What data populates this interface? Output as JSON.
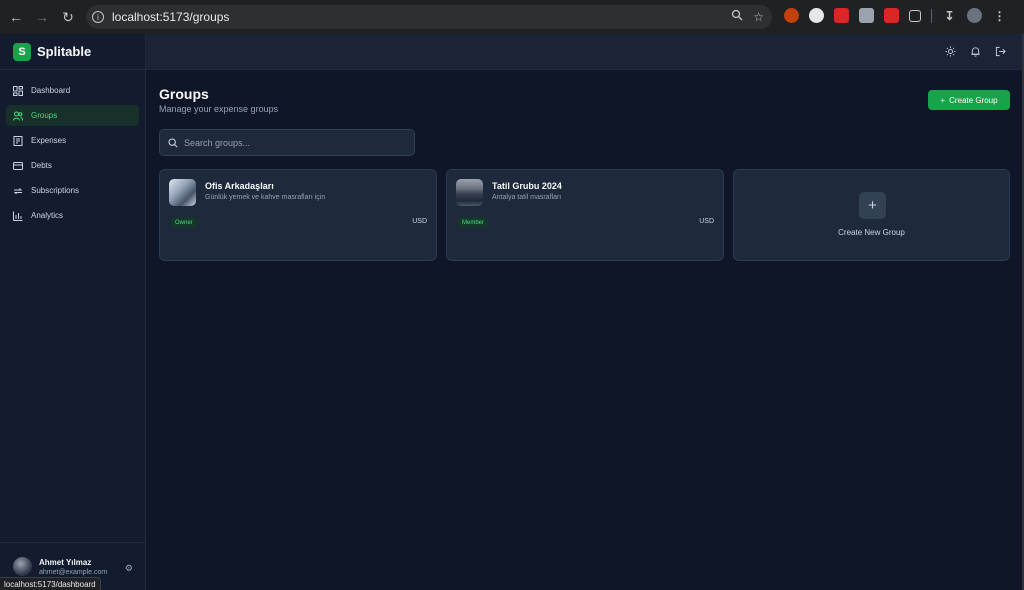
{
  "browser": {
    "url": "localhost:5173/groups",
    "status_url": "localhost:5173/dashboard"
  },
  "app": {
    "brand_letter": "S",
    "brand_name": "Splitable"
  },
  "sidebar": {
    "items": [
      {
        "label": "Dashboard",
        "icon": "dashboard-icon",
        "active": false
      },
      {
        "label": "Groups",
        "icon": "users-icon",
        "active": true
      },
      {
        "label": "Expenses",
        "icon": "receipt-icon",
        "active": false
      },
      {
        "label": "Debts",
        "icon": "credit-card-icon",
        "active": false
      },
      {
        "label": "Subscriptions",
        "icon": "repeat-icon",
        "active": false
      },
      {
        "label": "Analytics",
        "icon": "bar-chart-icon",
        "active": false
      }
    ]
  },
  "user": {
    "name": "Ahmet Yılmaz",
    "email": "ahmet@example.com"
  },
  "page": {
    "title": "Groups",
    "subtitle": "Manage your expense groups",
    "create_button": "Create Group"
  },
  "search": {
    "placeholder": "Search groups..."
  },
  "groups": [
    {
      "name": "Ofis Arkadaşları",
      "description": "Günlük yemek ve kahve masrafları için",
      "role": "Owner",
      "currency": "USD"
    },
    {
      "name": "Tatil Grubu 2024",
      "description": "Antalya tatil masrafları",
      "role": "Member",
      "currency": "USD"
    }
  ],
  "new_group": {
    "plus": "+",
    "label": "Create New Group"
  },
  "colors": {
    "accent": "#16a34a",
    "background": "#0e1627",
    "card": "#1e293b"
  }
}
